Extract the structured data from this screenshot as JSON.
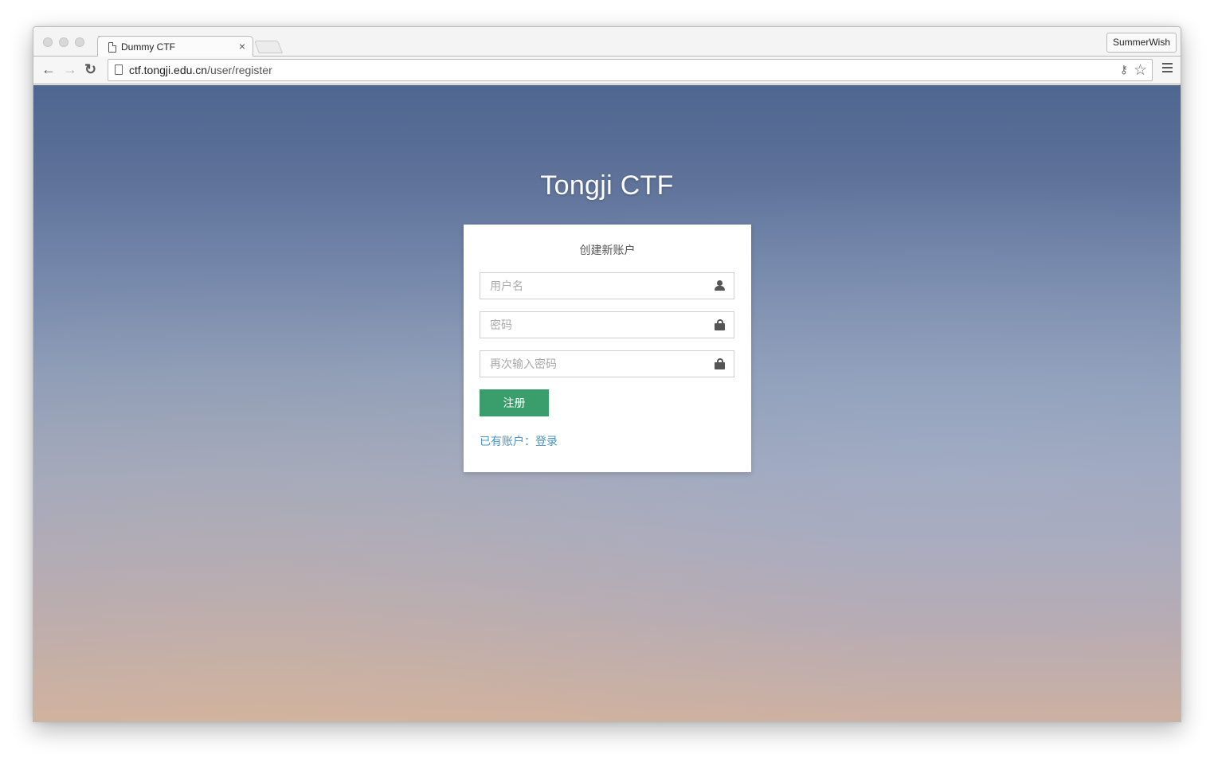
{
  "browser": {
    "tab_title": "Dummy CTF",
    "tab_close": "×",
    "profile_name": "SummerWish",
    "url_host": "ctf.tongji.edu.cn",
    "url_path": "/user/register",
    "icons": {
      "back": "←",
      "forward": "→",
      "reload": "↻",
      "key": "⚷",
      "star": "☆"
    }
  },
  "page": {
    "site_title": "Tongji CTF",
    "form": {
      "heading": "创建新账户",
      "username_placeholder": "用户名",
      "password_placeholder": "密码",
      "confirm_placeholder": "再次输入密码",
      "submit_label": "注册",
      "login_prompt": "已有账户：",
      "login_link": "登录"
    },
    "colors": {
      "submit_button": "#3a9d6c",
      "link": "#4b93be",
      "background_top": "#4e6690",
      "background_bottom": "#cfb0a0"
    }
  }
}
